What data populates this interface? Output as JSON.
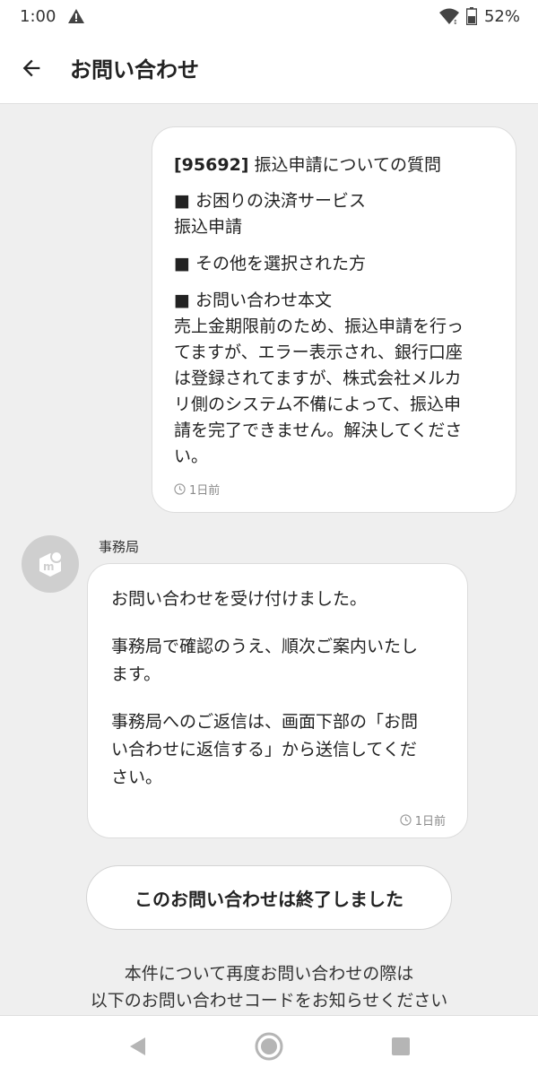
{
  "status_bar": {
    "time": "1:00",
    "battery": "52%",
    "icons": [
      "warning-icon",
      "wifi-icon",
      "battery-icon"
    ]
  },
  "app_bar": {
    "title": "お問い合わせ",
    "back_icon": "arrow-left-icon"
  },
  "user_message": {
    "subject_code": "[95692]",
    "subject_text": " 振込申請についての質問",
    "sections": [
      {
        "heading": "お困りの決済サービス",
        "body": [
          "振込申請"
        ]
      },
      {
        "heading": "その他を選択された方",
        "body": []
      },
      {
        "heading": "お問い合わせ本文",
        "body": [
          "売上金期限前のため、振込申請を行っ",
          "てますが、エラー表示され、銀行口座",
          "は登録されてますが、株式会社メルカ",
          "リ側のシステム不備によって、振込申",
          "請を完了できません。解決してくださ",
          "い。"
        ]
      }
    ],
    "time": "1日前"
  },
  "staff_message": {
    "sender": "事務局",
    "paragraphs": [
      [
        "お問い合わせを受け付けました。"
      ],
      [
        "事務局で確認のうえ、順次ご案内いたし",
        "ます。"
      ],
      [
        "事務局へのご返信は、画面下部の「お問",
        "い合わせに返信する」から送信してくだ",
        "さい。"
      ]
    ],
    "time": "1日前"
  },
  "closed_button_label": "このお問い合わせは終了しました",
  "notice_lines": [
    "本件について再度お問い合わせの際は",
    "以下のお問い合わせコードをお知らせください"
  ],
  "colors": {
    "background": "#efefef",
    "bubble": "#ffffff",
    "avatar": "#cfcfcf"
  }
}
